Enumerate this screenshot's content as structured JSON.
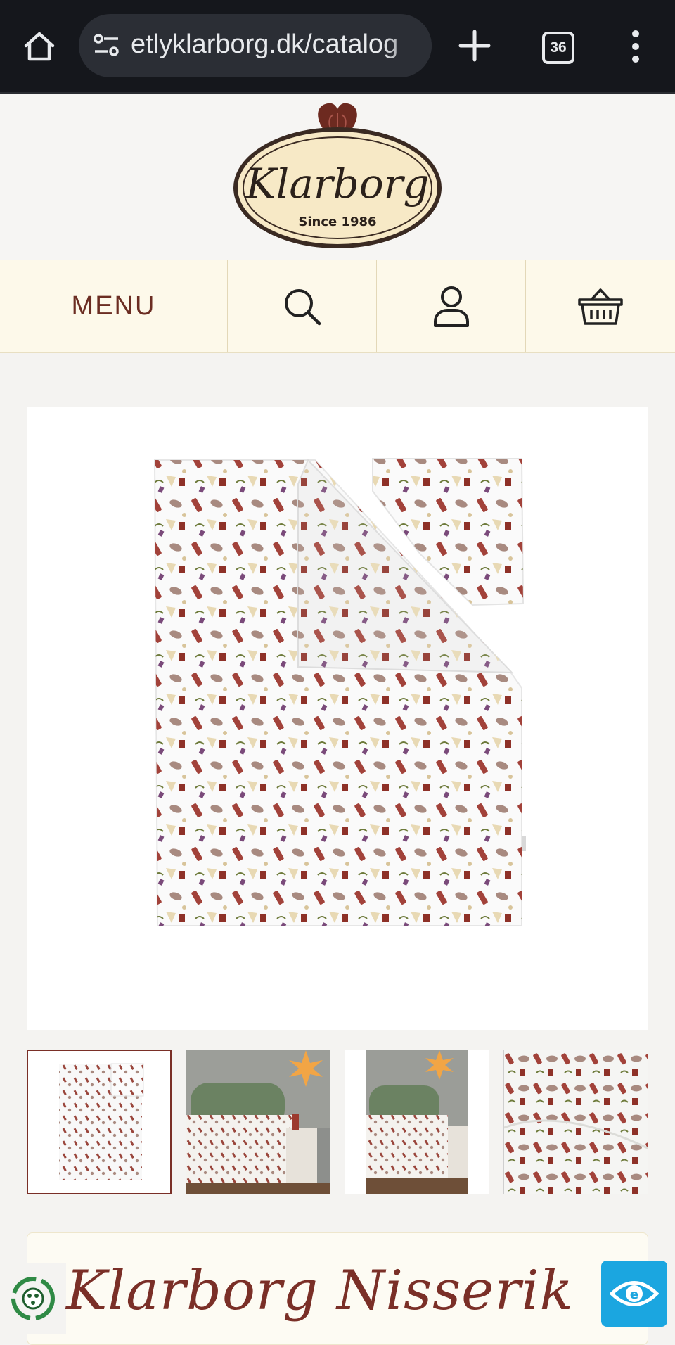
{
  "browser": {
    "url": "etlyklarborg.dk/catalog",
    "tab_count": "36",
    "icons": {
      "home": "home-icon",
      "site_settings": "tune-icon",
      "new_tab": "plus-icon",
      "tabs": "tab-switcher-icon",
      "more": "more-vert-icon"
    }
  },
  "header": {
    "logo_script": "Klarborg",
    "logo_tagline": "Since 1986"
  },
  "nav": {
    "menu_label": "MENU",
    "icons": [
      "search-icon",
      "user-icon",
      "basket-icon"
    ]
  },
  "gallery": {
    "main_image": "duvet-and-pillow-cover-product-photo",
    "thumbnails": [
      {
        "name": "thumbnail-1",
        "active": true
      },
      {
        "name": "thumbnail-2",
        "active": false
      },
      {
        "name": "thumbnail-3",
        "active": false
      },
      {
        "name": "thumbnail-4",
        "active": false
      }
    ]
  },
  "product": {
    "title": "Klarborg Nisserik"
  },
  "colors": {
    "brand_red": "#7a2f27",
    "nav_bg": "#fdf9ea",
    "accessibility_blue": "#1ba6e0",
    "chrome_bg": "#15171c"
  }
}
